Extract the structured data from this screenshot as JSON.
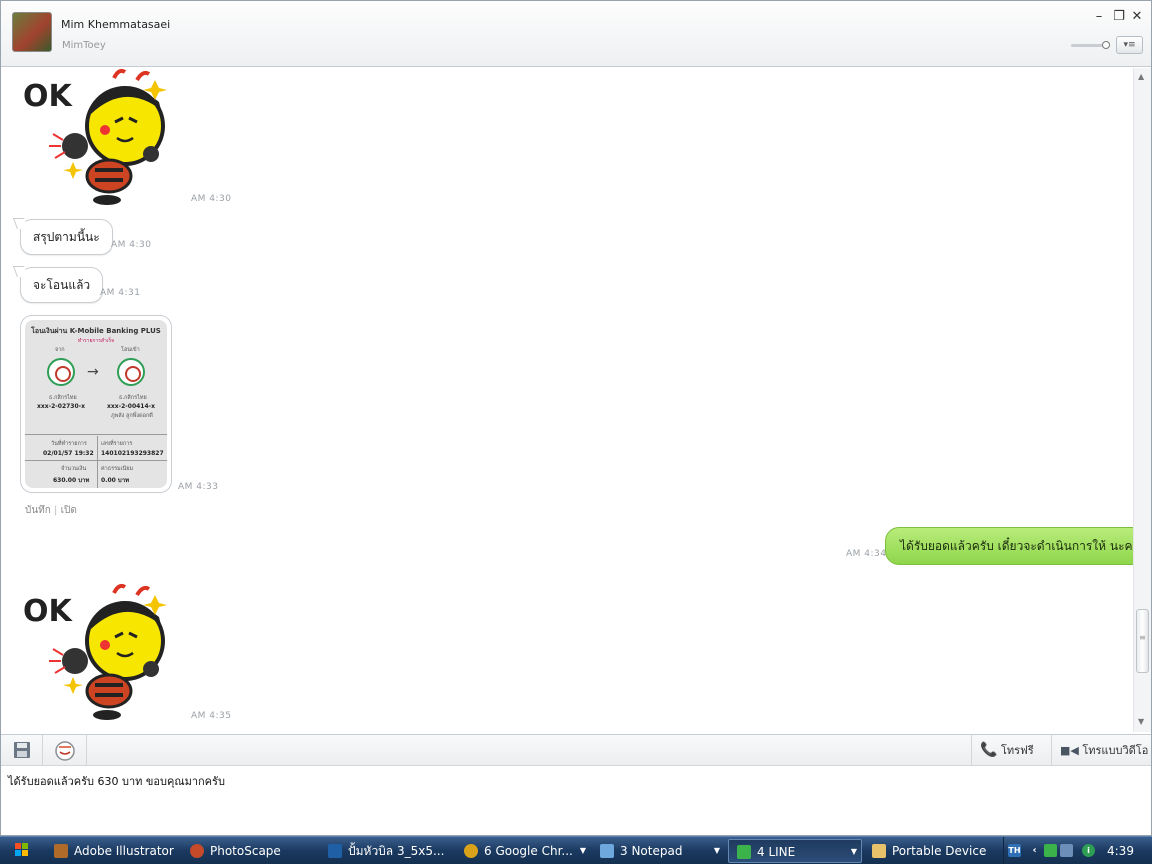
{
  "header": {
    "contact_name": "Mim  Khemmatasaei",
    "contact_id": "MimToey",
    "minimize": "–",
    "restore": "❐",
    "close": "✕",
    "menu_glyph": "▾≡"
  },
  "messages": [
    {
      "type": "sticker",
      "side": "left",
      "sticker_text": "OK",
      "time": "AM 4:30"
    },
    {
      "type": "text",
      "side": "left",
      "text": "สรุปตามนี้นะ",
      "time": "AM 4:30"
    },
    {
      "type": "text",
      "side": "left",
      "text": "จะโอนแล้ว",
      "time": "AM 4:31"
    },
    {
      "type": "image",
      "side": "left",
      "time": "AM 4:33"
    },
    {
      "type": "text",
      "side": "right",
      "text": "ได้รับยอดแล้วครับ เดี๋ยวจะดำเนินการให้ นะครับ",
      "time": "AM 4:34"
    },
    {
      "type": "sticker",
      "side": "left",
      "sticker_text": "OK",
      "time": "AM 4:35"
    }
  ],
  "image_actions": {
    "save": "บันทึก",
    "open": "เปิด"
  },
  "receipt": {
    "title": "โอนเงินผ่าน K-Mobile Banking PLUS",
    "subtitle": "ทำรายการสำเร็จ",
    "from_label": "จาก",
    "to_label": "โอนเข้า",
    "from_bank": "ธ.กสิกรไทย",
    "to_bank": "ธ.กสิกรไทย",
    "from_account": "xxx-2-02730-x",
    "to_account": "xxx-2-00414-x",
    "to_name": "ภูพลัง ลูกพึ่งดอกดี",
    "date_label": "วันที่ทำรายการ",
    "date_value": "02/01/57  19:32",
    "ref_label": "เลขที่รายการ",
    "ref_value": "140102193293827",
    "amount_label": "จำนวนเงิน",
    "amount_value": "630.00  บาท",
    "fee_label": "ค่าธรรมเนียม",
    "fee_value": "0.00  บาท"
  },
  "toolbar": {
    "call_label": "โทรฟรี",
    "video_label": "โทรแบบวิดีโอ"
  },
  "input": {
    "value": "ได้รับยอดแล้วครับ   630 บาท ขอบคุณมากครับ"
  },
  "taskbar": {
    "tasks": [
      {
        "label": "Adobe Illustrator",
        "icon_color": "#b06a2a"
      },
      {
        "label": "PhotoScape",
        "icon_color": "#c44a2a"
      },
      {
        "label": "ปั้มหัวบิล 3_5x5...",
        "icon_color": "#1f5fa6"
      },
      {
        "label": "6 Google Chr...",
        "icon_color": "#d9a21b"
      },
      {
        "label": "3 Notepad",
        "icon_color": "#6fa8dc"
      },
      {
        "label": "4 LINE",
        "icon_color": "#3cb34a"
      },
      {
        "label": "Portable Device",
        "icon_color": "#e7c26a"
      }
    ],
    "lang": "TH",
    "clock": "4:39"
  },
  "colors": {
    "line_green": "#8fd64b",
    "accent_bar": "#2b4d78"
  }
}
